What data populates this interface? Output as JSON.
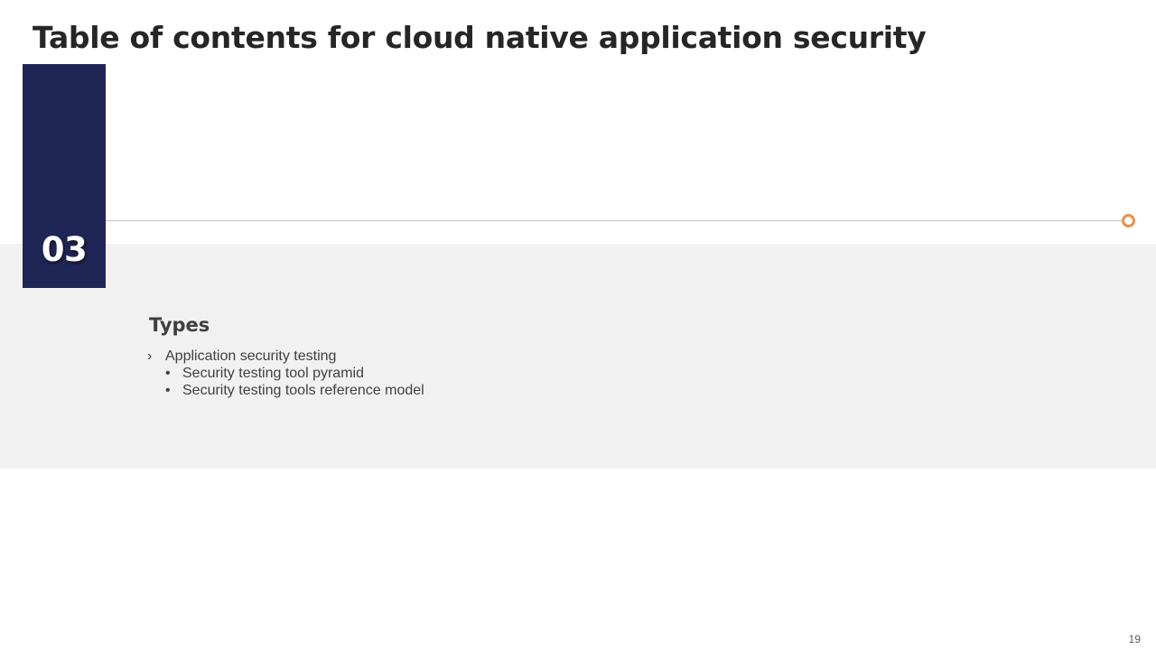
{
  "slide": {
    "title": "Table of contents for cloud native application security",
    "section_number": "03",
    "section_heading": "Types",
    "items": [
      {
        "marker": "›",
        "label": "Application security testing",
        "level": 1
      },
      {
        "marker": "•",
        "label": "Security testing tool pyramid",
        "level": 2
      },
      {
        "marker": "•",
        "label": "Security testing tools reference model",
        "level": 2
      }
    ],
    "page_number": "19"
  },
  "colors": {
    "number_box": "#1f2555",
    "accent_dot": "#e8914f",
    "band": "#f1f1f1",
    "title_text": "#262626"
  },
  "icons": {
    "timeline_end": "ring-dot-icon"
  }
}
